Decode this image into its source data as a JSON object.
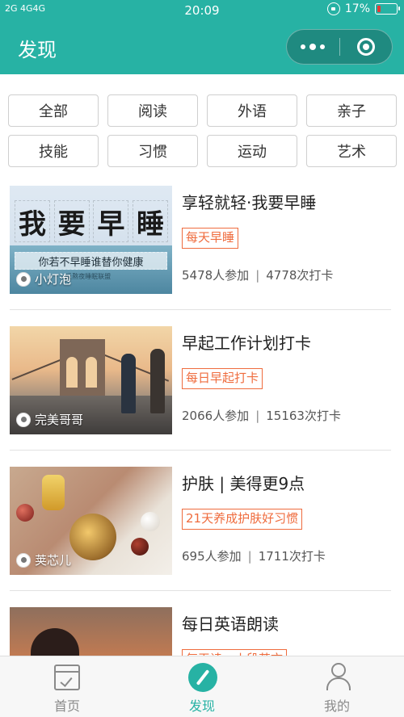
{
  "status_bar": {
    "left": "2G 4G4G",
    "time": "20:09",
    "battery": "17%",
    "battery_level": 0.17
  },
  "header": {
    "title": "发现"
  },
  "categories": [
    "全部",
    "阅读",
    "外语",
    "亲子",
    "技能",
    "习惯",
    "运动",
    "艺术"
  ],
  "items": [
    {
      "title": "享轻就轻·我要早睡",
      "tag": "每天早睡",
      "participants": "5478人参加",
      "checkins": "4778次打卡",
      "author": "小灯泡",
      "thumb": {
        "chars": [
          "我",
          "要",
          "早",
          "睡"
        ],
        "subtitle": "你若不早睡谁替你健康",
        "small": "· 反熬夜睡眠联盟"
      }
    },
    {
      "title": "早起工作计划打卡",
      "tag": "每日早起打卡",
      "participants": "2066人参加",
      "checkins": "15163次打卡",
      "author": "完美哥哥"
    },
    {
      "title": "护肤 | 美得更9点",
      "tag": "21天养成护肤好习惯",
      "participants": "695人参加",
      "checkins": "1711次打卡",
      "author": "荚芯儿"
    },
    {
      "title": "每日英语朗读",
      "tag": "每天读一小段英文",
      "participants": "",
      "checkins": "",
      "author": ""
    }
  ],
  "tabbar": [
    {
      "label": "首页",
      "icon": "home-check-icon"
    },
    {
      "label": "发现",
      "icon": "compass-icon"
    },
    {
      "label": "我的",
      "icon": "user-icon"
    }
  ],
  "colors": {
    "accent": "#27b2a4",
    "tag": "#ef6c3e"
  }
}
